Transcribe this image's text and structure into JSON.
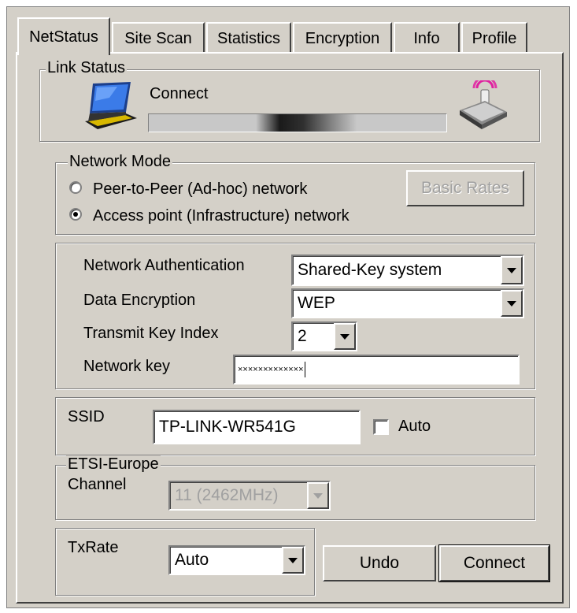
{
  "tabs": [
    "NetStatus",
    "Site Scan",
    "Statistics",
    "Encryption",
    "Info",
    "Profile"
  ],
  "link_status": {
    "title": "Link Status",
    "status_text": "Connect",
    "laptop_icon": "laptop-icon",
    "router_icon": "wireless-router-icon"
  },
  "network_mode": {
    "title": "Network Mode",
    "options": [
      "Peer-to-Peer (Ad-hoc) network",
      "Access point (Infrastructure) network"
    ],
    "selected": 1,
    "basic_rates_label": "Basic Rates"
  },
  "security": {
    "auth_label": "Network Authentication",
    "auth_value": "Shared-Key system",
    "encryption_label": "Data Encryption",
    "encryption_value": "WEP",
    "key_index_label": "Transmit Key Index",
    "key_index_value": "2",
    "network_key_label": "Network key",
    "network_key_value": "×××××××××××××"
  },
  "ssid": {
    "label": "SSID",
    "value": "TP-LINK-WR541G",
    "auto_label": "Auto",
    "auto_checked": false
  },
  "region": {
    "title": "ETSI-Europe",
    "channel_label": "Channel",
    "channel_value": "11  (2462MHz)"
  },
  "txrate": {
    "label": "TxRate",
    "value": "Auto"
  },
  "buttons": {
    "undo": "Undo",
    "connect": "Connect"
  },
  "colors": {
    "dialog_face": "#d4d0c8",
    "router_signal": "#e020a0",
    "laptop_screen": "#2a6ad8"
  }
}
